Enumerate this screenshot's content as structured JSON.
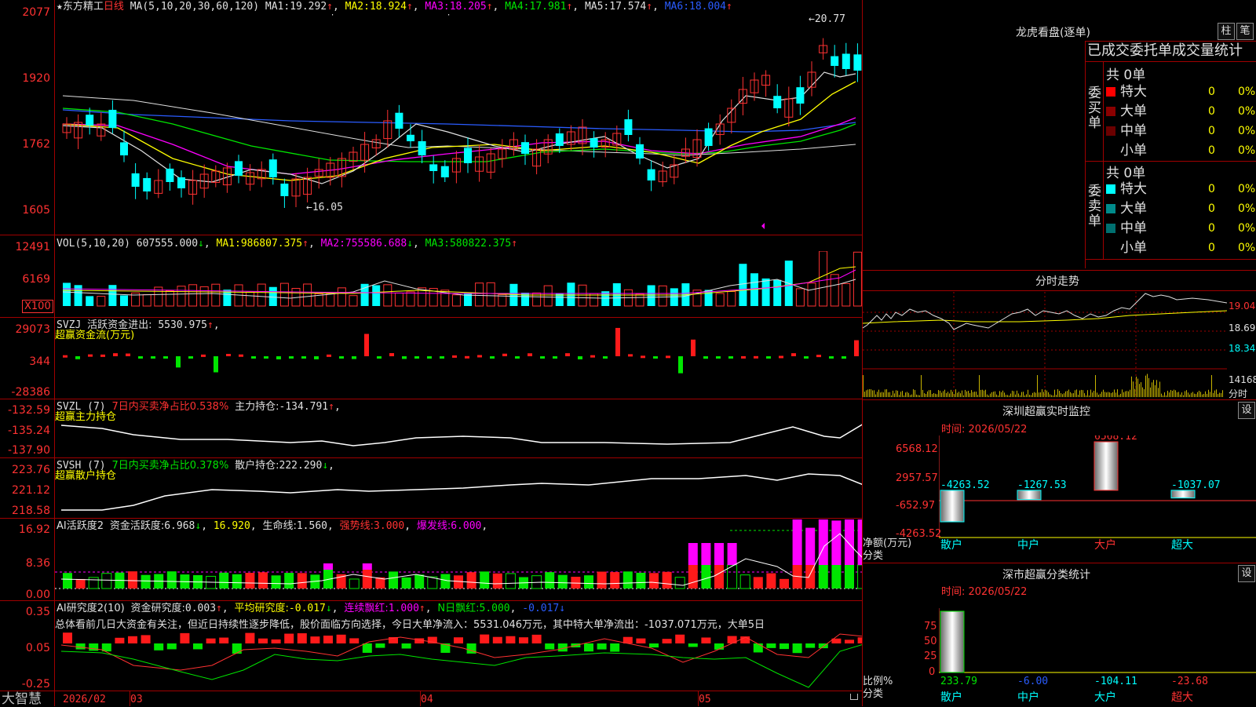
{
  "main_chart": {
    "title_star": "★",
    "stock_name": "东方精工",
    "period": "日线",
    "ma_params": "MA(5,10,20,30,60,120)",
    "ma_items": [
      {
        "label": "MA1:",
        "value": "19.292",
        "arrow": "↑",
        "color": "#e0e0e0"
      },
      {
        "label": "MA2:",
        "value": "18.924",
        "arrow": "↑",
        "color": "#ffff00"
      },
      {
        "label": "MA3:",
        "value": "18.205",
        "arrow": "↑",
        "color": "#ff00ff"
      },
      {
        "label": "MA4:",
        "value": "17.981",
        "arrow": "↑",
        "color": "#00e600"
      },
      {
        "label": "MA5:",
        "value": "17.574",
        "arrow": "↑",
        "color": "#e0e0e0"
      },
      {
        "label": "MA6:",
        "value": "18.004",
        "arrow": "↑",
        "color": "#2a5cff"
      }
    ],
    "y_ticks": [
      "2077",
      "1920",
      "1762",
      "1605"
    ],
    "high_marker": "20.77",
    "low_marker": "16.05"
  },
  "vol_panel": {
    "title": "VOL(5,10,20)",
    "value": "607555.000",
    "value_arrow": "↓",
    "ma1_label": "MA1:",
    "ma1": "986807.375",
    "ma1_arrow": "↑",
    "ma2_label": "MA2:",
    "ma2": "755586.688",
    "ma2_arrow": "↓",
    "ma3_label": "MA3:",
    "ma3": "580822.375",
    "ma3_arrow": "↑",
    "y_ticks": [
      "12491",
      "6169"
    ],
    "unit": "X100"
  },
  "svzj_panel": {
    "title": "SVZJ",
    "label": "活跃资金进出:",
    "value": "5530.975",
    "arrow": "↑",
    "subtitle": "超赢资金流(万元)",
    "y_ticks": [
      "29073",
      "344",
      "-28386"
    ]
  },
  "svzl_panel": {
    "title": "SVZL (7)",
    "label1": "7日内买卖净占比0.538%",
    "label2": "主力持仓:",
    "value": "-134.791",
    "arrow": "↑",
    "subtitle": "超赢主力持仓",
    "y_ticks": [
      "-132.59",
      "-135.24",
      "-137.90"
    ]
  },
  "svsh_panel": {
    "title": "SVSH (7)",
    "label1": "7日内买卖净占比0.378%",
    "label2": "散户持仓:",
    "value": "222.290",
    "arrow": "↓",
    "subtitle": "超赢散户持仓",
    "y_ticks": [
      "223.76",
      "221.12",
      "218.58"
    ]
  },
  "ai1_panel": {
    "title": "AI活跃度2",
    "label": "资金活跃度:",
    "value": "6.968",
    "arrow": "↓",
    "value2": "16.920",
    "life_label": "生命线:",
    "life": "1.560",
    "strong_label": "强势线:",
    "strong": "3.000",
    "burst_label": "爆发线:",
    "burst": "6.000",
    "y_ticks": [
      "16.92",
      "8.36",
      "0.00"
    ]
  },
  "ai2_panel": {
    "title": "AI研究度2(10)",
    "label": "资金研究度:",
    "value": "0.003",
    "arrow": "↑",
    "avg_label": "平均研究度:",
    "avg": "-0.017",
    "avg_arrow": "↓",
    "red_label": "连续飘红:",
    "red": "1.000",
    "red_arrow": "↑",
    "n_label": "N日飘红:",
    "n": "5.000",
    "extra": "-0.017",
    "extra_arrow": "↓",
    "summary": "总体看前几日大资金有关注，但近日持续性逐步降低，股价面临方向选择，今日大单净流入：5531.046万元，其中特大单净流出：-1037.071万元，大单5日",
    "y_ticks": [
      "0.35",
      "0.05",
      "-0.25"
    ]
  },
  "bottom_bar": {
    "brand": "大智慧",
    "dates": [
      "2026/02",
      "03",
      "04",
      "05"
    ]
  },
  "right_panel": {
    "longhu_title": "龙虎看盘(逐单)",
    "btn_zhu": "柱",
    "btn_bi": "笔",
    "stats_title": "已成交委托单成交量统计",
    "buy_side_label": "委买单",
    "sell_side_label": "委卖单",
    "buy_total": "共 0单",
    "sell_total": "共 0单",
    "buy_rows": [
      {
        "name": "特大",
        "count": "0",
        "pct": "0%",
        "color": "#ff0000"
      },
      {
        "name": "大单",
        "count": "0",
        "pct": "0%",
        "color": "#8b0000"
      },
      {
        "name": "中单",
        "count": "0",
        "pct": "0%",
        "color": "#6b0000"
      },
      {
        "name": "小单",
        "count": "0",
        "pct": "0%",
        "color": ""
      }
    ],
    "sell_rows": [
      {
        "name": "特大",
        "count": "0",
        "pct": "0%",
        "color": "#00ffff"
      },
      {
        "name": "大单",
        "count": "0",
        "pct": "0%",
        "color": "#008b8b"
      },
      {
        "name": "中单",
        "count": "0",
        "pct": "0%",
        "color": "#007070"
      },
      {
        "name": "小单",
        "count": "0",
        "pct": "0%",
        "color": ""
      }
    ],
    "intraday_title": "分时走势",
    "intraday_ticks": [
      "19.04",
      "18.69",
      "18.34",
      "14168"
    ],
    "intraday_unit": "分时",
    "monitor_title": "深圳超赢实时监控",
    "monitor_btn": "设",
    "monitor_time": "时间: 2026/05/22",
    "monitor_y": [
      "6568.12",
      "2957.57",
      "-652.97",
      "-4263.52"
    ],
    "monitor_axis_label": "净额(万元)",
    "monitor_axis_label2": "分类",
    "monitor_bars": [
      {
        "name": "散户",
        "value": -4263.52,
        "label": "-4263.52"
      },
      {
        "name": "中户",
        "value": -1267.53,
        "label": "-1267.53"
      },
      {
        "name": "大户",
        "value": 6568.12,
        "label": "6568.12"
      },
      {
        "name": "超大",
        "value": -1037.07,
        "label": "-1037.07"
      }
    ],
    "stats2_title": "深市超赢分类统计",
    "stats2_btn": "设",
    "stats2_time": "时间: 2026/05/22",
    "stats2_y": [
      "75",
      "50",
      "25",
      "0"
    ],
    "stats2_axis_label": "比例%",
    "stats2_axis_label2": "分类",
    "stats2_values": [
      {
        "name": "散户",
        "label": "233.79",
        "color": "#00e600"
      },
      {
        "name": "中户",
        "label": "-6.00",
        "color": "#2a5cff"
      },
      {
        "name": "大户",
        "label": "-104.11",
        "color": "#00ffff"
      },
      {
        "name": "超大",
        "label": "-23.68",
        "color": "#ff3232"
      }
    ]
  }
}
